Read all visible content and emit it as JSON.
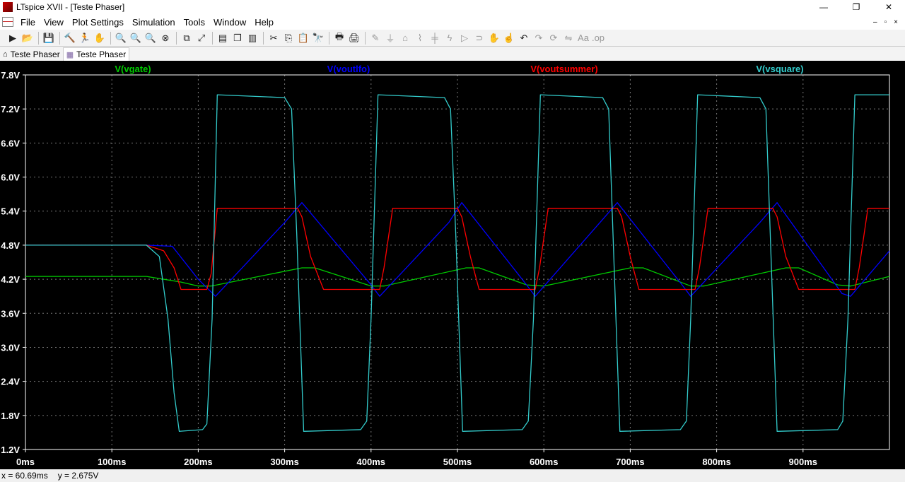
{
  "window": {
    "title": "LTspice XVII - [Teste Phaser]",
    "controls": [
      "—",
      "❐",
      "✕"
    ]
  },
  "menu": {
    "items": [
      "File",
      "View",
      "Plot Settings",
      "Simulation",
      "Tools",
      "Window",
      "Help"
    ],
    "mdi_controls": [
      "–",
      "▫",
      "×"
    ]
  },
  "toolbar": {
    "buttons": [
      {
        "name": "run-icon",
        "glyph": "▶"
      },
      {
        "name": "open-icon",
        "glyph": "📂"
      },
      {
        "sep": true
      },
      {
        "name": "save-icon",
        "glyph": "💾"
      },
      {
        "sep": true
      },
      {
        "name": "control-panel-icon",
        "glyph": "🔨"
      },
      {
        "name": "run-sim-icon",
        "glyph": "🏃"
      },
      {
        "name": "pan-hand-icon",
        "glyph": "✋"
      },
      {
        "sep": true
      },
      {
        "name": "zoom-in-icon",
        "glyph": "🔍"
      },
      {
        "name": "zoom-area-icon",
        "glyph": "🔍"
      },
      {
        "name": "zoom-out-icon",
        "glyph": "🔍"
      },
      {
        "name": "zoom-cancel-icon",
        "glyph": "⊗"
      },
      {
        "sep": true
      },
      {
        "name": "autorange-icon",
        "glyph": "⧉"
      },
      {
        "name": "fit-icon",
        "glyph": "⤢"
      },
      {
        "sep": true
      },
      {
        "name": "tile-horizontal-icon",
        "glyph": "▤"
      },
      {
        "name": "cascade-icon",
        "glyph": "❐"
      },
      {
        "name": "tile-vertical-icon",
        "glyph": "▥"
      },
      {
        "sep": true
      },
      {
        "name": "cut-icon",
        "glyph": "✂"
      },
      {
        "name": "copy-icon",
        "glyph": "⎘"
      },
      {
        "name": "paste-icon",
        "glyph": "📋"
      },
      {
        "name": "find-icon",
        "glyph": "🔭"
      },
      {
        "sep": true
      },
      {
        "name": "print-icon",
        "glyph": "🖶"
      },
      {
        "name": "print-setup-icon",
        "glyph": "🖨"
      },
      {
        "sep": true
      },
      {
        "name": "wire-icon",
        "glyph": "✎",
        "dim": true
      },
      {
        "name": "ground-icon",
        "glyph": "⏚",
        "dim": true
      },
      {
        "name": "label-net-icon",
        "glyph": "⌂",
        "dim": true
      },
      {
        "name": "resistor-icon",
        "glyph": "⌇",
        "dim": true
      },
      {
        "name": "capacitor-icon",
        "glyph": "╪",
        "dim": true
      },
      {
        "name": "inductor-icon",
        "glyph": "ϟ",
        "dim": true
      },
      {
        "name": "diode-icon",
        "glyph": "▷",
        "dim": true
      },
      {
        "name": "component-icon",
        "glyph": "⊃",
        "dim": true
      },
      {
        "name": "move-icon",
        "glyph": "✋",
        "dim": true
      },
      {
        "name": "drag-icon",
        "glyph": "☝",
        "dim": true
      },
      {
        "name": "undo-icon",
        "glyph": "↶"
      },
      {
        "name": "redo-icon",
        "glyph": "↷",
        "dim": true
      },
      {
        "name": "rotate-icon",
        "glyph": "⟳",
        "dim": true
      },
      {
        "name": "mirror-icon",
        "glyph": "⇋",
        "dim": true
      },
      {
        "name": "text-icon",
        "glyph": "Aa",
        "dim": true
      },
      {
        "name": "spice-directive-icon",
        "glyph": ".op",
        "dim": true
      }
    ]
  },
  "tabs": [
    {
      "label": "Teste Phaser",
      "icon": "schematic-icon",
      "glyph": "⌂",
      "active": false
    },
    {
      "label": "Teste Phaser",
      "icon": "waveform-icon",
      "glyph": "▦",
      "active": true
    }
  ],
  "status": {
    "x_readout": "x = 60.69ms",
    "y_readout": "y = 2.675V"
  },
  "chart_data": {
    "type": "line",
    "title": "",
    "xlabel": "",
    "ylabel": "",
    "xlim": [
      0,
      1000
    ],
    "ylim": [
      1.2,
      7.8
    ],
    "x_ticks": [
      "0ms",
      "100ms",
      "200ms",
      "300ms",
      "400ms",
      "500ms",
      "600ms",
      "700ms",
      "800ms",
      "900ms"
    ],
    "x_tick_values": [
      0,
      100,
      200,
      300,
      400,
      500,
      600,
      700,
      800,
      900
    ],
    "y_ticks": [
      "7.8V",
      "7.2V",
      "6.6V",
      "6.0V",
      "5.4V",
      "4.8V",
      "4.2V",
      "3.6V",
      "3.0V",
      "2.4V",
      "1.8V",
      "1.2V"
    ],
    "y_tick_values": [
      7.8,
      7.2,
      6.6,
      6.0,
      5.4,
      4.8,
      4.2,
      3.6,
      3.0,
      2.4,
      1.8,
      1.2
    ],
    "grid": true,
    "background": "#000000",
    "axis_color": "#ffffff",
    "series": [
      {
        "name": "V(vgate)",
        "color": "#00cc00",
        "x": [
          0,
          140,
          180,
          200,
          215,
          320,
          335,
          400,
          415,
          510,
          525,
          580,
          600,
          700,
          715,
          770,
          785,
          880,
          895,
          940,
          955,
          1000
        ],
        "y": [
          4.25,
          4.25,
          4.15,
          4.08,
          4.08,
          4.4,
          4.4,
          4.08,
          4.08,
          4.4,
          4.4,
          4.1,
          4.08,
          4.4,
          4.4,
          4.08,
          4.08,
          4.4,
          4.4,
          4.1,
          4.08,
          4.25
        ]
      },
      {
        "name": "V(voutlfo)",
        "color": "#0000ff",
        "x": [
          0,
          140,
          170,
          200,
          220,
          300,
          320,
          400,
          410,
          490,
          505,
          580,
          590,
          665,
          685,
          760,
          770,
          850,
          870,
          945,
          955,
          1000
        ],
        "y": [
          4.8,
          4.8,
          4.78,
          4.2,
          3.9,
          5.2,
          5.55,
          4.1,
          3.9,
          5.2,
          5.55,
          4.1,
          3.9,
          5.2,
          5.55,
          4.1,
          3.9,
          5.2,
          5.55,
          3.95,
          3.9,
          4.7
        ]
      },
      {
        "name": "V(voutsummer)",
        "color": "#ff0000",
        "x": [
          0,
          140,
          160,
          172,
          180,
          210,
          215,
          222,
          315,
          320,
          330,
          345,
          410,
          415,
          425,
          500,
          505,
          515,
          525,
          590,
          595,
          605,
          685,
          690,
          700,
          710,
          775,
          780,
          790,
          865,
          870,
          880,
          895,
          960,
          965,
          975,
          1000
        ],
        "y": [
          4.8,
          4.8,
          4.7,
          4.4,
          4.02,
          4.02,
          4.3,
          5.45,
          5.45,
          5.3,
          4.6,
          4.02,
          4.02,
          4.4,
          5.45,
          5.45,
          5.3,
          4.6,
          4.02,
          4.02,
          4.4,
          5.45,
          5.45,
          5.3,
          4.6,
          4.02,
          4.02,
          4.4,
          5.45,
          5.45,
          5.3,
          4.6,
          4.02,
          4.02,
          4.4,
          5.45,
          5.45
        ]
      },
      {
        "name": "V(vsquare)",
        "color": "#33cccc",
        "x": [
          0,
          140,
          155,
          165,
          172,
          178,
          205,
          210,
          216,
          222,
          300,
          308,
          314,
          322,
          388,
          395,
          400,
          408,
          485,
          492,
          498,
          506,
          575,
          582,
          588,
          596,
          668,
          675,
          680,
          688,
          758,
          765,
          770,
          778,
          850,
          857,
          862,
          870,
          940,
          946,
          952,
          960,
          1000
        ],
        "y": [
          4.8,
          4.8,
          4.6,
          3.5,
          2.2,
          1.52,
          1.55,
          1.65,
          3.5,
          7.45,
          7.4,
          7.2,
          5.0,
          1.52,
          1.55,
          1.7,
          3.5,
          7.45,
          7.4,
          7.2,
          5.0,
          1.52,
          1.55,
          1.7,
          3.5,
          7.45,
          7.4,
          7.2,
          5.0,
          1.52,
          1.55,
          1.7,
          3.5,
          7.45,
          7.4,
          7.2,
          5.0,
          1.52,
          1.55,
          1.7,
          3.5,
          7.45,
          7.45
        ]
      }
    ]
  }
}
